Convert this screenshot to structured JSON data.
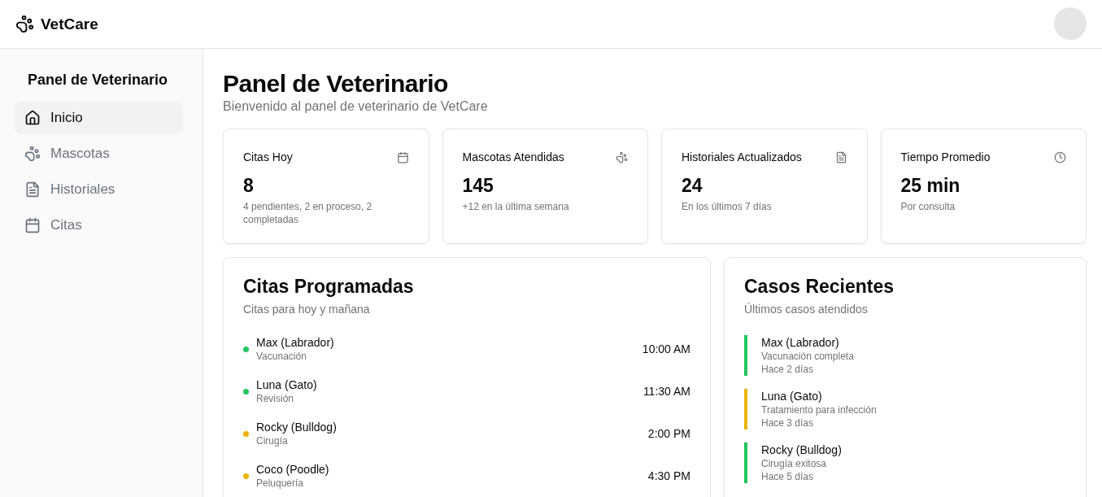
{
  "brand": {
    "name": "VetCare"
  },
  "sidebar": {
    "title": "Panel de Veterinario",
    "items": [
      {
        "label": "Inicio",
        "kind": "home",
        "selected": true
      },
      {
        "label": "Mascotas",
        "kind": "paw",
        "selected": false
      },
      {
        "label": "Historiales",
        "kind": "file",
        "selected": false
      },
      {
        "label": "Citas",
        "kind": "calendar",
        "selected": false
      }
    ]
  },
  "page": {
    "title": "Panel de Veterinario",
    "subtitle": "Bienvenido al panel de veterinario de VetCare"
  },
  "stats": [
    {
      "title": "Citas Hoy",
      "kind": "calendar",
      "value": "8",
      "note": "4 pendientes, 2 en proceso, 2 completadas"
    },
    {
      "title": "Mascotas Atendidas",
      "kind": "paw",
      "value": "145",
      "note": "+12 en la última semana"
    },
    {
      "title": "Historiales Actualizados",
      "kind": "file",
      "value": "24",
      "note": "En los últimos 7 días"
    },
    {
      "title": "Tiempo Promedio",
      "kind": "clock",
      "value": "25 min",
      "note": "Por consulta"
    }
  ],
  "appointments": {
    "title": "Citas Programadas",
    "subtitle": "Citas para hoy y mañana",
    "items": [
      {
        "pet": "Max (Labrador)",
        "reason": "Vacunación",
        "time": "10:00 AM",
        "color": "#22c55e"
      },
      {
        "pet": "Luna (Gato)",
        "reason": "Revisión",
        "time": "11:30 AM",
        "color": "#22c55e"
      },
      {
        "pet": "Rocky (Bulldog)",
        "reason": "Cirugía",
        "time": "2:00 PM",
        "color": "#eab308"
      },
      {
        "pet": "Coco (Poodle)",
        "reason": "Peluquería",
        "time": "4:30 PM",
        "color": "#eab308"
      }
    ]
  },
  "recent_cases": {
    "title": "Casos Recientes",
    "subtitle": "Últimos casos atendidos",
    "items": [
      {
        "pet": "Max (Labrador)",
        "detail": "Vacunación completa",
        "when": "Hace 2 días",
        "color": "#22c55e"
      },
      {
        "pet": "Luna (Gato)",
        "detail": "Tratamiento para infección",
        "when": "Hace 3 días",
        "color": "#eab308"
      },
      {
        "pet": "Rocky (Bulldog)",
        "detail": "Cirugía exitosa",
        "when": "Hace 5 días",
        "color": "#22c55e"
      }
    ]
  }
}
